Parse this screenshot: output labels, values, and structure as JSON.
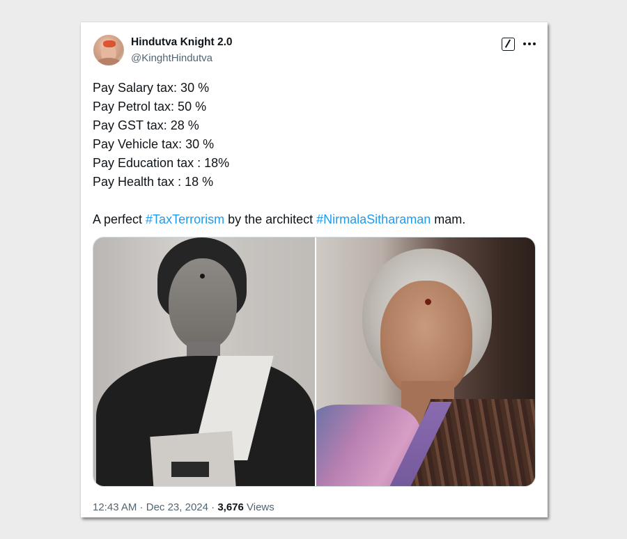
{
  "author": {
    "display_name": "Hindutva Knight 2.0",
    "handle": "@KinghtHindutva",
    "avatar_icon": "user-avatar-photo"
  },
  "header_actions": {
    "edit_icon": "edit-square-icon",
    "more_icon": "more-dots-icon"
  },
  "tweet": {
    "lines": [
      "Pay Salary tax: 30 %",
      "Pay Petrol tax: 50 %",
      "Pay GST tax: 28 %",
      "Pay Vehicle tax: 30 %",
      "Pay Education tax : 18%",
      "Pay Health tax : 18 %"
    ],
    "closing_prefix": "A perfect ",
    "hashtag_1": "#TaxTerrorism",
    "closing_middle": " by the architect ",
    "hashtag_2": "#NirmalaSitharaman",
    "closing_suffix": " mam."
  },
  "media": {
    "photo_count": 2
  },
  "meta": {
    "time": "12:43 AM",
    "separator": " · ",
    "date": "Dec 23, 2024",
    "views_count": "3,676",
    "views_label": " Views"
  },
  "colors": {
    "text": "#0f1419",
    "secondary": "#536471",
    "hashtag": "#1d9bf0",
    "page_bg": "#ececec"
  }
}
